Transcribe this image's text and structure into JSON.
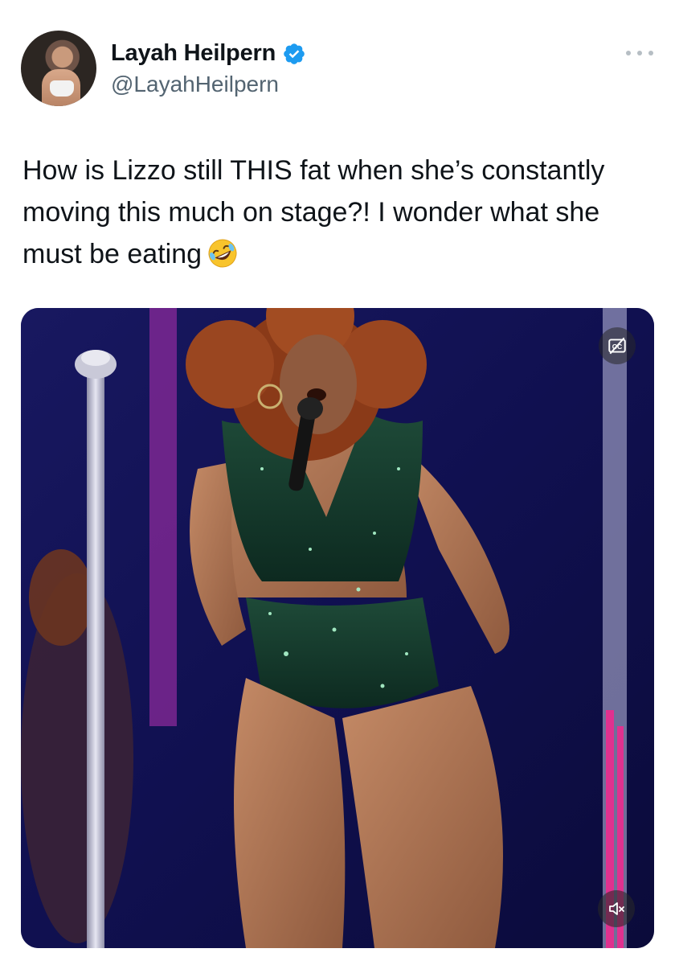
{
  "author": {
    "display_name": "Layah Heilpern",
    "handle": "@LayahHeilpern",
    "verified": true,
    "avatar_icon": "profile-photo"
  },
  "tweet": {
    "text": "How is Lizzo still THIS fat when she’s constantly moving this much on stage?! I wonder what she must be eating",
    "emoji": "rolling-on-the-floor-laughing"
  },
  "media": {
    "type": "video",
    "cc_icon": "closed-captions-off-icon",
    "mute_icon": "speaker-muted-icon"
  },
  "colors": {
    "verified_blue": "#1d9bf0",
    "handle_gray": "#536471",
    "text": "#0f1419",
    "stage_blue": "#12124a",
    "stage_pink": "#e0318f"
  },
  "menu": {
    "more_icon": "more-options-icon"
  }
}
